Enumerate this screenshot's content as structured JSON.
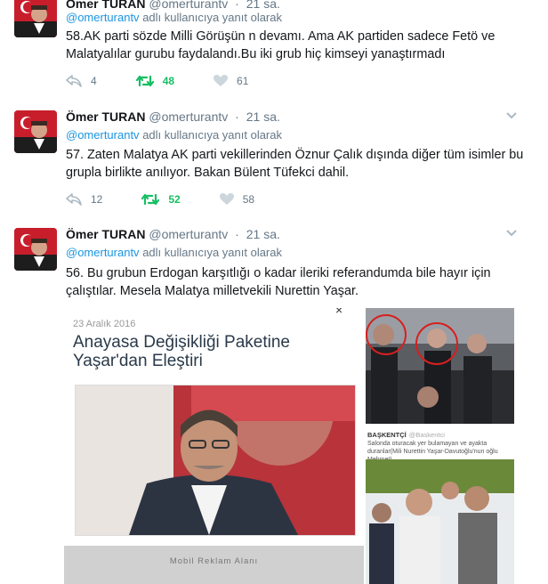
{
  "tweets": [
    {
      "name": "Ömer TURAN",
      "handle": "@omerturantv",
      "time": "21 sa.",
      "reply_handle": "@omerturantv",
      "reply_suffix": "adlı kullanıcıya yanıt olarak",
      "text": "58.AK parti sözde Milli Görüşün n devamı. Ama AK partiden sadece Fetö ve Malatyalılar gurubu faydalandı.Bu iki grub hiç kimseyi yanaştırmadı",
      "replies": "4",
      "retweets": "48",
      "likes": "61"
    },
    {
      "name": "Ömer TURAN",
      "handle": "@omerturantv",
      "time": "21 sa.",
      "reply_handle": "@omerturantv",
      "reply_suffix": "adlı kullanıcıya yanıt olarak",
      "text": "57. Zaten Malatya AK parti vekillerinden Öznur Çalık dışında diğer tüm isimler bu grupla birlikte anılıyor. Bakan Bülent Tüfekci dahil.",
      "replies": "12",
      "retweets": "52",
      "likes": "58"
    },
    {
      "name": "Ömer TURAN",
      "handle": "@omerturantv",
      "time": "21 sa.",
      "reply_handle": "@omerturantv",
      "reply_suffix": "adlı kullanıcıya yanıt olarak",
      "text": "56. Bu grubun Erdogan karşıtlığı o kadar ileriki referandumda bile hayır için çalıştılar. Mesela Malatya milletvekili Nurettin Yaşar."
    }
  ],
  "media": {
    "article_date": "23 Aralık 2016",
    "article_title": "Anayasa Değişikliği Paketine Yaşar'dan Eleştiri",
    "close_glyph": "×",
    "ad_label": "Mobil Reklam Alanı",
    "side_brand": "BAŞKENTÇİ",
    "side_brand_handle": "@Baskentci",
    "side_caption": "Salonda oturacak yer bulamayan ve ayakta duranlar(Mili Nurettin Yaşar-Davutoğlu'nun oğlu Mehmet)"
  },
  "colors": {
    "retweet_green": "#17bf63",
    "link_blue": "#1b95e0",
    "text_gray": "#657786"
  }
}
